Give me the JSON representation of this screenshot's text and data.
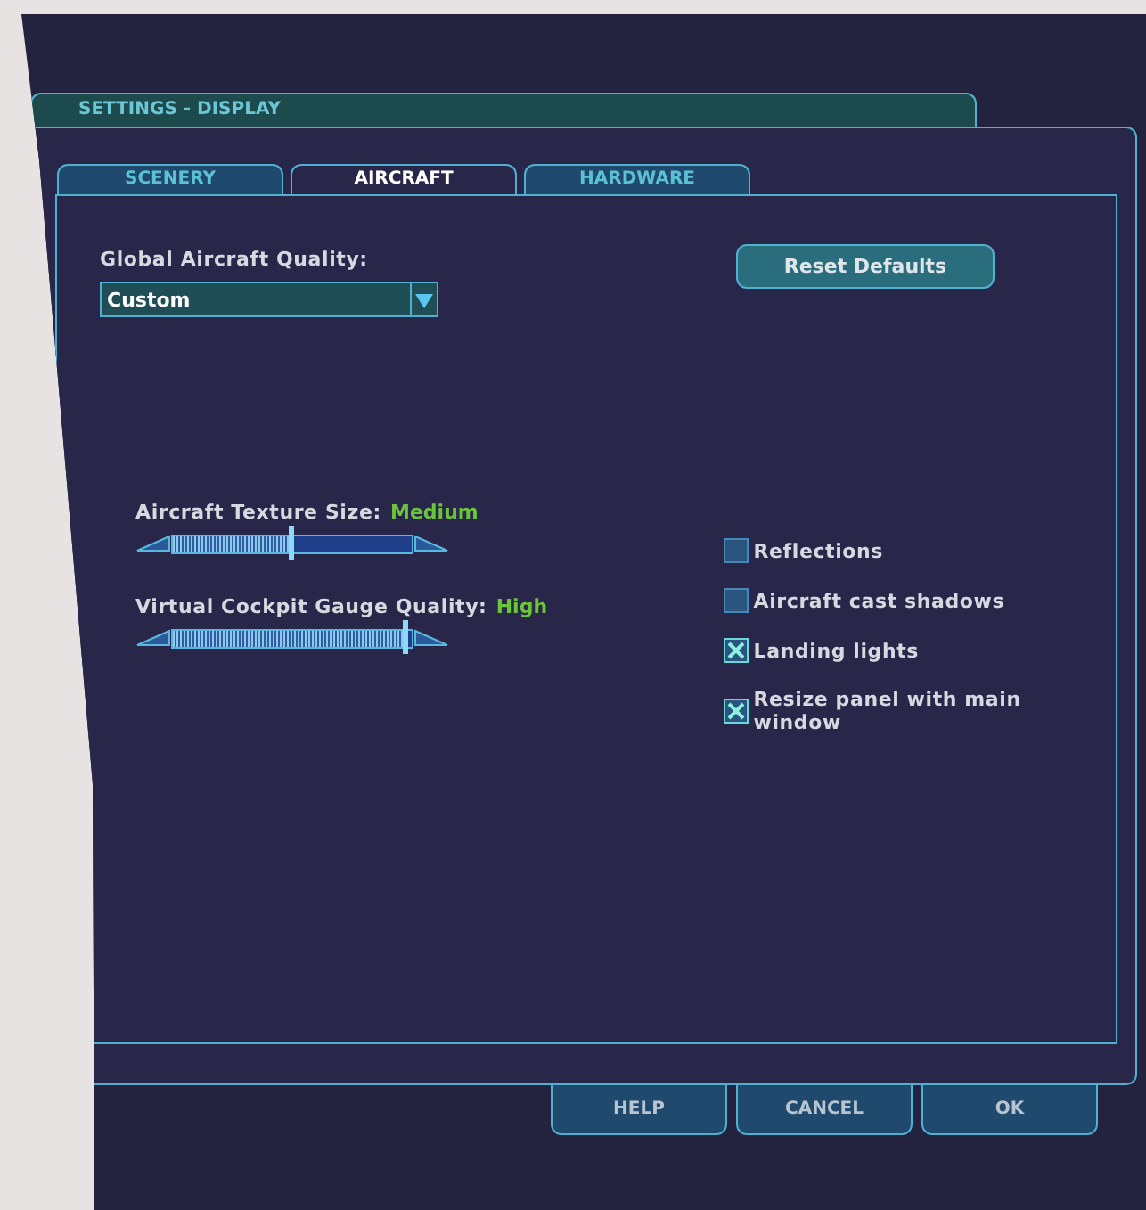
{
  "window": {
    "title": "SETTINGS - DISPLAY"
  },
  "tabs": [
    {
      "label": "SCENERY",
      "selected": false
    },
    {
      "label": "AIRCRAFT",
      "selected": true
    },
    {
      "label": "HARDWARE",
      "selected": false
    }
  ],
  "quality": {
    "label": "Global Aircraft Quality:",
    "value": "Custom"
  },
  "reset_button": "Reset Defaults",
  "sliders": [
    {
      "label": "Aircraft Texture Size:",
      "reading": "Medium",
      "level": 0.49
    },
    {
      "label": "Virtual Cockpit Gauge Quality:",
      "reading": "High",
      "level": 0.97
    }
  ],
  "options": [
    {
      "label": "Reflections",
      "checked": false
    },
    {
      "label": "Aircraft cast shadows",
      "checked": false
    },
    {
      "label": "Landing lights",
      "checked": true
    },
    {
      "label": "Resize panel with main window",
      "checked": true
    }
  ],
  "buttons": [
    "HELP",
    "CANCEL",
    "OK"
  ]
}
